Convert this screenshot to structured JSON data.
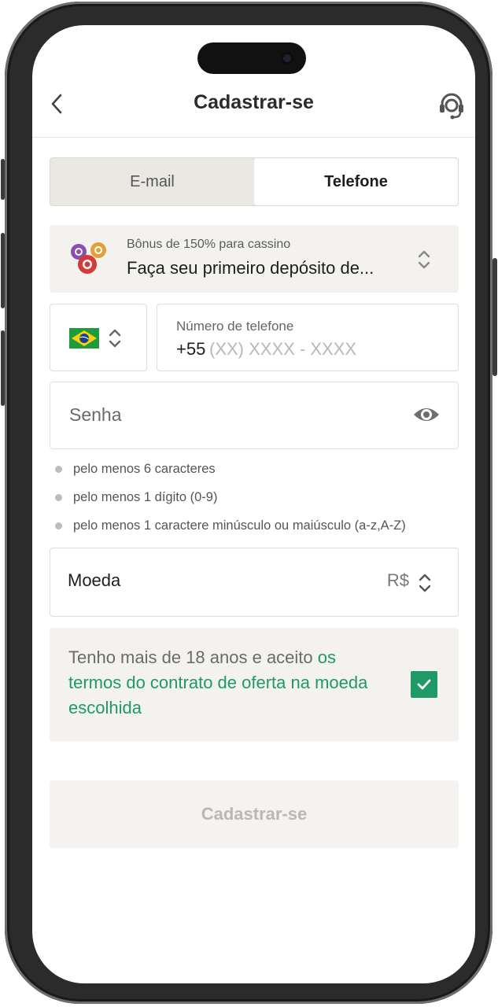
{
  "header": {
    "title": "Cadastrar-se"
  },
  "tabs": [
    {
      "label": "E-mail"
    },
    {
      "label": "Telefone"
    }
  ],
  "bonus": {
    "subtitle": "Bônus de 150% para cassino",
    "text": "Faça seu primeiro depósito de..."
  },
  "phone": {
    "label": "Número de telefone",
    "prefix": "+55",
    "placeholder": "(XX) XXXX - XXXX"
  },
  "password": {
    "placeholder": "Senha"
  },
  "rules": [
    "pelo menos 6 caracteres",
    "pelo menos 1 dígito (0-9)",
    "pelo menos 1 caractere minúsculo ou maiúsculo (a-z,A-Z)"
  ],
  "currency": {
    "label": "Moeda",
    "value": "R$"
  },
  "terms": {
    "text": "Tenho mais de 18 anos e aceito ",
    "link": "os termos do contrato de oferta na moeda escolhida",
    "checked": true
  },
  "submit": {
    "label": "Cadastrar-se"
  },
  "colors": {
    "accent": "#1f9a66",
    "panel": "#f3f2ee",
    "tab_bg": "#e9e8e2"
  },
  "icons": [
    "back-icon",
    "support-headset-icon",
    "casino-chips-icon",
    "chevron-updown-icon",
    "brazil-flag-icon",
    "eye-icon",
    "checkmark-icon"
  ]
}
